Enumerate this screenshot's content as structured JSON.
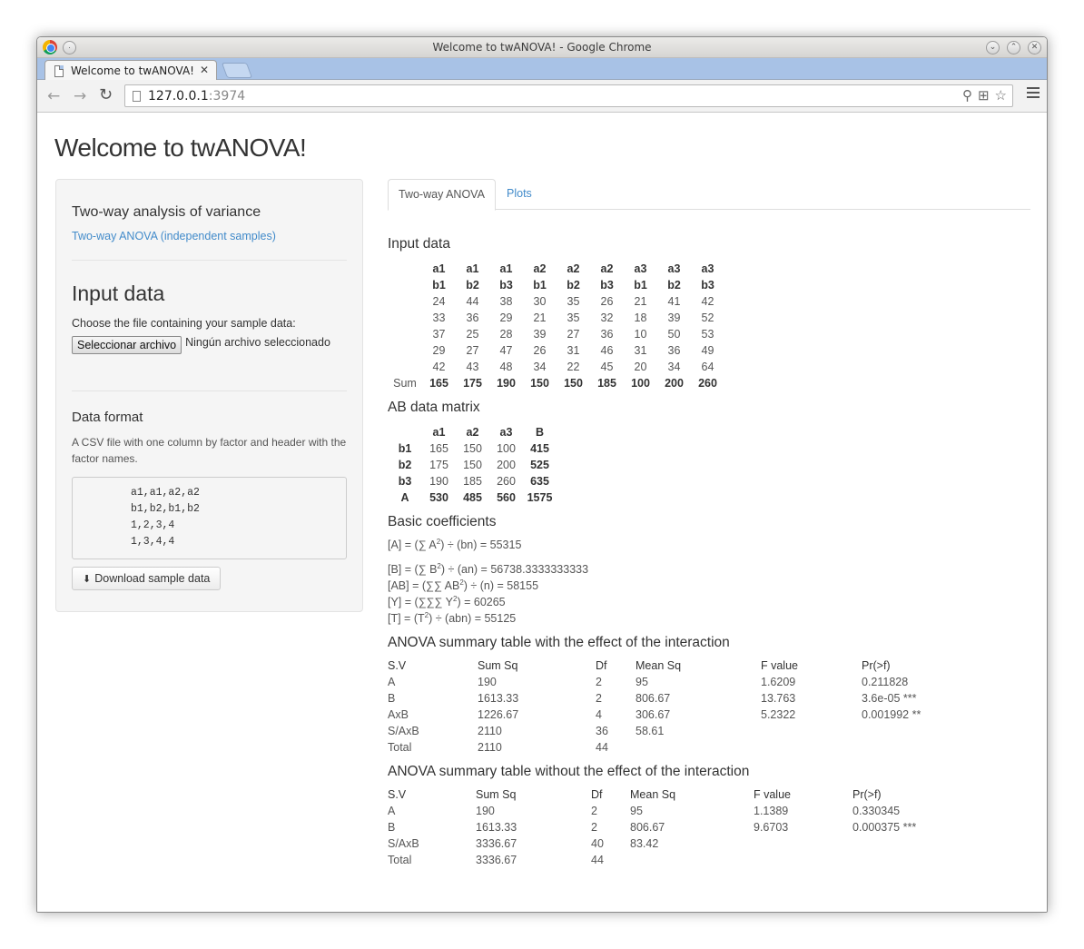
{
  "window": {
    "title": "Welcome to twANOVA! - Google Chrome",
    "tab_title": "Welcome to twANOVA!",
    "url_host": "127.0.0.1",
    "url_port": ":3974"
  },
  "page": {
    "title": "Welcome to twANOVA!"
  },
  "sidebar": {
    "heading": "Two-way analysis of variance",
    "link": "Two-way ANOVA (independent samples)",
    "input_heading": "Input data",
    "choose_label": "Choose the file containing your sample data:",
    "file_button": "Seleccionar archivo",
    "file_none": "Ningún archivo seleccionado",
    "format_heading": "Data format",
    "format_desc": "A CSV file with one column by factor and header with the factor names.",
    "sample_lines": [
      "a1,a1,a2,a2",
      "b1,b2,b1,b2",
      "1,2,3,4",
      "1,3,4,4"
    ],
    "download_button": "Download sample data"
  },
  "tabs": [
    {
      "label": "Two-way ANOVA"
    },
    {
      "label": "Plots"
    }
  ],
  "input_data": {
    "title": "Input data",
    "header_a": [
      "a1",
      "a1",
      "a1",
      "a2",
      "a2",
      "a2",
      "a3",
      "a3",
      "a3"
    ],
    "header_b": [
      "b1",
      "b2",
      "b3",
      "b1",
      "b2",
      "b3",
      "b1",
      "b2",
      "b3"
    ],
    "rows": [
      [
        "24",
        "44",
        "38",
        "30",
        "35",
        "26",
        "21",
        "41",
        "42"
      ],
      [
        "33",
        "36",
        "29",
        "21",
        "35",
        "32",
        "18",
        "39",
        "52"
      ],
      [
        "37",
        "25",
        "28",
        "39",
        "27",
        "36",
        "10",
        "50",
        "53"
      ],
      [
        "29",
        "27",
        "47",
        "26",
        "31",
        "46",
        "31",
        "36",
        "49"
      ],
      [
        "42",
        "43",
        "48",
        "34",
        "22",
        "45",
        "20",
        "34",
        "64"
      ]
    ],
    "sum_label": "Sum",
    "sums": [
      "165",
      "175",
      "190",
      "150",
      "150",
      "185",
      "100",
      "200",
      "260"
    ]
  },
  "ab_matrix": {
    "title": "AB data matrix",
    "header": [
      "a1",
      "a2",
      "a3",
      "B"
    ],
    "rows": [
      {
        "label": "b1",
        "values": [
          "165",
          "150",
          "100"
        ],
        "total": "415"
      },
      {
        "label": "b2",
        "values": [
          "175",
          "150",
          "200"
        ],
        "total": "525"
      },
      {
        "label": "b3",
        "values": [
          "190",
          "185",
          "260"
        ],
        "total": "635"
      }
    ],
    "total_row": {
      "label": "A",
      "values": [
        "530",
        "485",
        "560",
        "1575"
      ]
    }
  },
  "coefficients": {
    "title": "Basic coefficients",
    "A": {
      "pre": "[A] = (∑ A",
      "post": ") ÷ (bn) = 55315"
    },
    "B": {
      "pre": "[B] = (∑ B",
      "post": ") ÷ (an) = 56738.3333333333"
    },
    "AB": {
      "pre": "[AB] = (∑∑ AB",
      "post": ") ÷ (n) = 58155"
    },
    "Y": {
      "pre": "[Y] = (∑∑∑ Y",
      "post": ") = 60265"
    },
    "T": {
      "pre": "[T] = (T",
      "post": ") ÷ (abn) = 55125"
    },
    "exp": "2"
  },
  "anova_with": {
    "title": "ANOVA summary table with the effect of the interaction",
    "header": [
      "S.V",
      "Sum Sq",
      "Df",
      "Mean Sq",
      "F value",
      "Pr(>f)"
    ],
    "rows": [
      [
        "A",
        "190",
        "2",
        "95",
        "1.6209",
        "0.211828"
      ],
      [
        "B",
        "1613.33",
        "2",
        "806.67",
        "13.763",
        "3.6e-05 ***"
      ],
      [
        "AxB",
        "1226.67",
        "4",
        "306.67",
        "5.2322",
        "0.001992 **"
      ],
      [
        "S/AxB",
        "2110",
        "36",
        "58.61",
        "",
        ""
      ],
      [
        "Total",
        "2110",
        "44",
        "",
        "",
        ""
      ]
    ]
  },
  "anova_without": {
    "title": "ANOVA summary table without the effect of the interaction",
    "header": [
      "S.V",
      "Sum Sq",
      "Df",
      "Mean Sq",
      "F value",
      "Pr(>f)"
    ],
    "rows": [
      [
        "A",
        "190",
        "2",
        "95",
        "1.1389",
        "0.330345"
      ],
      [
        "B",
        "1613.33",
        "2",
        "806.67",
        "9.6703",
        "0.000375 ***"
      ],
      [
        "S/AxB",
        "3336.67",
        "40",
        "83.42",
        "",
        ""
      ],
      [
        "Total",
        "3336.67",
        "44",
        "",
        "",
        ""
      ]
    ]
  }
}
